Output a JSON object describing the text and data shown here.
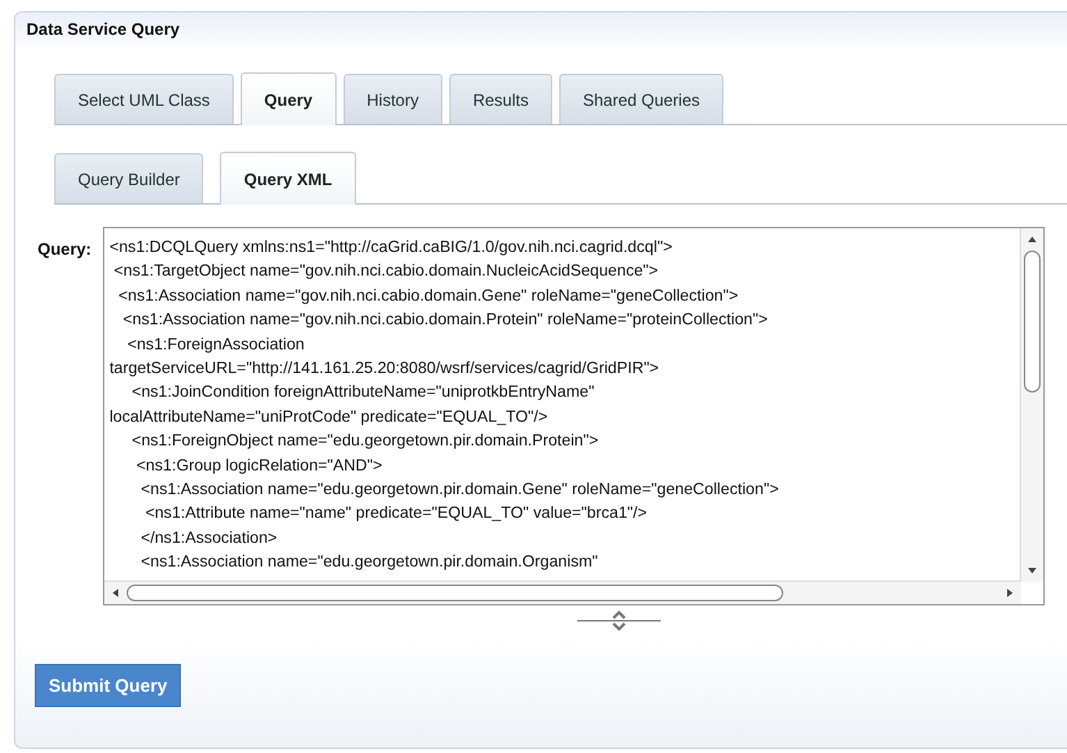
{
  "panel": {
    "title": "Data Service Query"
  },
  "tabs": [
    {
      "label": "Select UML Class",
      "selected": false
    },
    {
      "label": "Query",
      "selected": true
    },
    {
      "label": "History",
      "selected": false
    },
    {
      "label": "Results",
      "selected": false
    },
    {
      "label": "Shared Queries",
      "selected": false
    }
  ],
  "subtabs": [
    {
      "label": "Query Builder",
      "selected": false
    },
    {
      "label": "Query XML",
      "selected": true
    }
  ],
  "query": {
    "label": "Query:",
    "lines": [
      "<ns1:DCQLQuery xmlns:ns1=\"http://caGrid.caBIG/1.0/gov.nih.nci.cagrid.dcql\">",
      " <ns1:TargetObject name=\"gov.nih.nci.cabio.domain.NucleicAcidSequence\">",
      "  <ns1:Association name=\"gov.nih.nci.cabio.domain.Gene\" roleName=\"geneCollection\">",
      "   <ns1:Association name=\"gov.nih.nci.cabio.domain.Protein\" roleName=\"proteinCollection\">",
      "    <ns1:ForeignAssociation",
      "targetServiceURL=\"http://141.161.25.20:8080/wsrf/services/cagrid/GridPIR\">",
      "     <ns1:JoinCondition foreignAttributeName=\"uniprotkbEntryName\"",
      "localAttributeName=\"uniProtCode\" predicate=\"EQUAL_TO\"/>",
      "     <ns1:ForeignObject name=\"edu.georgetown.pir.domain.Protein\">",
      "      <ns1:Group logicRelation=\"AND\">",
      "       <ns1:Association name=\"edu.georgetown.pir.domain.Gene\" roleName=\"geneCollection\">",
      "        <ns1:Attribute name=\"name\" predicate=\"EQUAL_TO\" value=\"brca1\"/>",
      "       </ns1:Association>",
      "       <ns1:Association name=\"edu.georgetown.pir.domain.Organism\""
    ]
  },
  "submit": {
    "label": "Submit Query"
  }
}
